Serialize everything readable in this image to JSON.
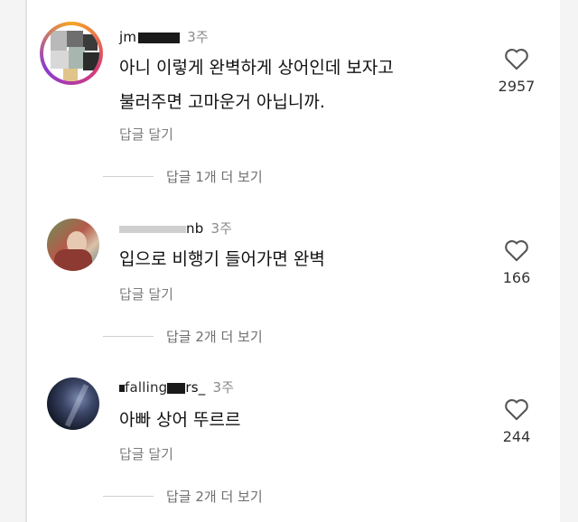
{
  "comments": [
    {
      "username": "jm",
      "time": "3주",
      "text_lines": [
        "아니 이렇게 완벽하게 상어인데 보자고",
        "불러주면 고마운거 아닙니까."
      ],
      "reply_label": "답글 달기",
      "more_replies": "답글 1개 더 보기",
      "likes": "2957"
    },
    {
      "username": "nb",
      "time": "3주",
      "text_lines": [
        "입으로 비행기 들어가면 완벽"
      ],
      "reply_label": "답글 달기",
      "more_replies": "답글 2개 더 보기",
      "likes": "166"
    },
    {
      "username_prefix": "falling",
      "username": "rs_",
      "time": "3주",
      "text_lines": [
        "아빠 상어 뚜르르"
      ],
      "reply_label": "답글 달기",
      "more_replies": "답글 2개 더 보기",
      "likes": "244"
    }
  ],
  "colors": {
    "background": "#ffffff",
    "secondary_text": "#7c7c7c",
    "primary_text": "#111111"
  },
  "icons": [
    "heart-icon"
  ]
}
